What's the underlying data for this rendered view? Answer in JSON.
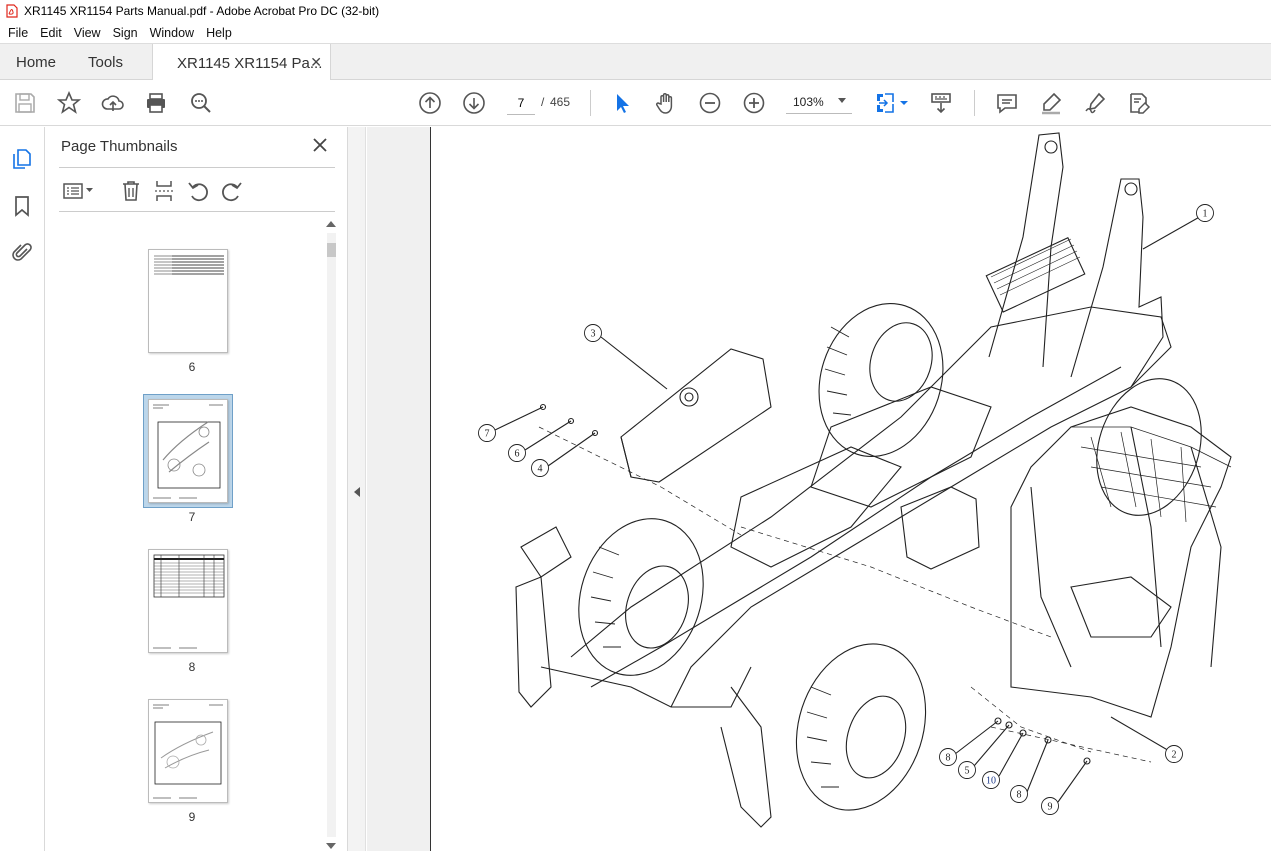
{
  "window": {
    "title": "XR1145 XR1154 Parts Manual.pdf - Adobe Acrobat Pro DC (32-bit)"
  },
  "menu": [
    "File",
    "Edit",
    "View",
    "Sign",
    "Window",
    "Help"
  ],
  "tabs": {
    "home": "Home",
    "tools": "Tools",
    "document": "XR1145 XR1154 Pa..."
  },
  "toolbar": {
    "current_page": "7",
    "page_separator": "/",
    "total_pages": "465",
    "zoom": "103%"
  },
  "panel": {
    "title": "Page Thumbnails",
    "thumbnails": [
      {
        "label": "6"
      },
      {
        "label": "7",
        "selected": true
      },
      {
        "label": "8"
      },
      {
        "label": "9"
      }
    ]
  },
  "diagram": {
    "callouts": [
      "1",
      "2",
      "3",
      "4",
      "5",
      "6",
      "7",
      "8",
      "8",
      "9",
      "10"
    ]
  },
  "colors": {
    "accent": "#1473e6",
    "selected_thumb": "#bcd6ea",
    "pdf_red": "#e0261b"
  }
}
